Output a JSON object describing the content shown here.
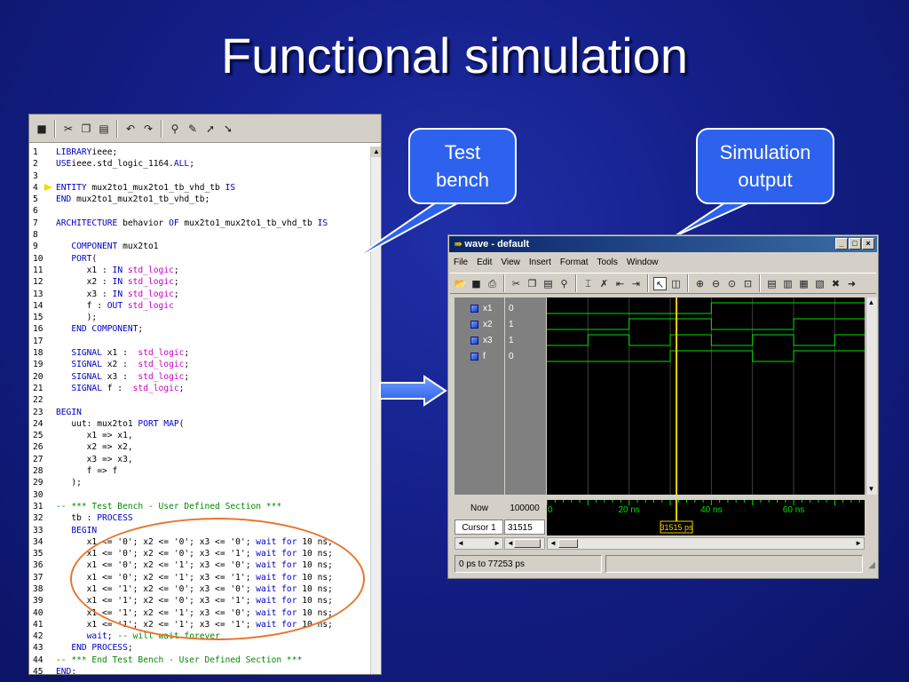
{
  "slide": {
    "title": "Functional simulation"
  },
  "callouts": {
    "testbench": [
      "Test",
      "bench"
    ],
    "output": [
      "Simulation",
      "output"
    ]
  },
  "editor": {
    "toolbar_icons": [
      "save-icon",
      "cut-icon",
      "copy-icon",
      "paste-icon",
      "undo-icon",
      "redo-icon",
      "find-icon",
      "mark-icon",
      "next-mark-icon",
      "prev-mark-icon"
    ],
    "current_line": 4,
    "lines": [
      {
        "n": "1",
        "t": [
          [
            "kw",
            "LIBRARY"
          ],
          [
            "",
            "ieee;"
          ]
        ]
      },
      {
        "n": "2",
        "t": [
          [
            "kw",
            "USE"
          ],
          [
            "",
            "ieee.std_logic_1164."
          ],
          [
            "kw",
            "ALL"
          ],
          [
            "",
            ";"
          ]
        ]
      },
      {
        "n": "3",
        "t": []
      },
      {
        "n": "4",
        "t": [
          [
            "kw",
            "ENTITY"
          ],
          [
            "",
            " mux2to1_mux2to1_tb_vhd_tb "
          ],
          [
            "kw",
            "IS"
          ]
        ]
      },
      {
        "n": "5",
        "t": [
          [
            "kw",
            "END"
          ],
          [
            "",
            " mux2to1_mux2to1_tb_vhd_tb;"
          ]
        ]
      },
      {
        "n": "6",
        "t": []
      },
      {
        "n": "7",
        "t": [
          [
            "kw",
            "ARCHITECTURE"
          ],
          [
            "",
            " behavior "
          ],
          [
            "kw",
            "OF"
          ],
          [
            "",
            " mux2to1_mux2to1_tb_vhd_tb "
          ],
          [
            "kw",
            "IS"
          ]
        ]
      },
      {
        "n": "8",
        "t": []
      },
      {
        "n": "9",
        "t": [
          [
            "",
            "   "
          ],
          [
            "kw",
            "COMPONENT"
          ],
          [
            "",
            " mux2to1"
          ]
        ]
      },
      {
        "n": "10",
        "t": [
          [
            "",
            "   "
          ],
          [
            "kw",
            "PORT"
          ],
          [
            "",
            "("
          ]
        ]
      },
      {
        "n": "11",
        "t": [
          [
            "",
            "      x1 : "
          ],
          [
            "kw",
            "IN"
          ],
          [
            "",
            "",
            " "
          ],
          [
            "ty",
            " std_logic"
          ],
          [
            "",
            ";"
          ]
        ]
      },
      {
        "n": "12",
        "t": [
          [
            "",
            "      x2 : "
          ],
          [
            "kw",
            "IN"
          ],
          [
            "ty",
            " std_logic"
          ],
          [
            "",
            ";"
          ]
        ]
      },
      {
        "n": "13",
        "t": [
          [
            "",
            "      x3 : "
          ],
          [
            "kw",
            "IN"
          ],
          [
            "ty",
            " std_logic"
          ],
          [
            "",
            ";"
          ]
        ]
      },
      {
        "n": "14",
        "t": [
          [
            "",
            "      f : "
          ],
          [
            "kw",
            "OUT"
          ],
          [
            "ty",
            " std_logic"
          ]
        ]
      },
      {
        "n": "15",
        "t": [
          [
            "",
            "      );"
          ]
        ]
      },
      {
        "n": "16",
        "t": [
          [
            "",
            "   "
          ],
          [
            "kw",
            "END COMPONENT"
          ],
          [
            "",
            ";"
          ]
        ]
      },
      {
        "n": "17",
        "t": []
      },
      {
        "n": "18",
        "t": [
          [
            "",
            "   "
          ],
          [
            "kw",
            "SIGNAL"
          ],
          [
            "",
            " x1 :  "
          ],
          [
            "ty",
            "std_logic"
          ],
          [
            "",
            ";"
          ]
        ]
      },
      {
        "n": "19",
        "t": [
          [
            "",
            "   "
          ],
          [
            "kw",
            "SIGNAL"
          ],
          [
            "",
            " x2 :  "
          ],
          [
            "ty",
            "std_logic"
          ],
          [
            "",
            ";"
          ]
        ]
      },
      {
        "n": "20",
        "t": [
          [
            "",
            "   "
          ],
          [
            "kw",
            "SIGNAL"
          ],
          [
            "",
            " x3 :  "
          ],
          [
            "ty",
            "std_logic"
          ],
          [
            "",
            ";"
          ]
        ]
      },
      {
        "n": "21",
        "t": [
          [
            "",
            "   "
          ],
          [
            "kw",
            "SIGNAL"
          ],
          [
            "",
            " f :  "
          ],
          [
            "ty",
            "std_logic"
          ],
          [
            "",
            ";"
          ]
        ]
      },
      {
        "n": "22",
        "t": []
      },
      {
        "n": "23",
        "t": [
          [
            "kw",
            "BEGIN"
          ]
        ]
      },
      {
        "n": "24",
        "t": [
          [
            "",
            "   uut: mux2to1 "
          ],
          [
            "kw",
            "PORT MAP"
          ],
          [
            "",
            "("
          ]
        ]
      },
      {
        "n": "25",
        "t": [
          [
            "",
            "      x1 => x1,"
          ]
        ]
      },
      {
        "n": "26",
        "t": [
          [
            "",
            "      x2 => x2,"
          ]
        ]
      },
      {
        "n": "27",
        "t": [
          [
            "",
            "      x3 => x3,"
          ]
        ]
      },
      {
        "n": "28",
        "t": [
          [
            "",
            "      f => f"
          ]
        ]
      },
      {
        "n": "29",
        "t": [
          [
            "",
            "   );"
          ]
        ]
      },
      {
        "n": "30",
        "t": []
      },
      {
        "n": "31",
        "t": [
          [
            "cm",
            "-- *** Test Bench - User Defined Section ***"
          ]
        ]
      },
      {
        "n": "32",
        "t": [
          [
            "",
            "   tb : "
          ],
          [
            "kw",
            "PROCESS"
          ]
        ]
      },
      {
        "n": "33",
        "t": [
          [
            "",
            "   "
          ],
          [
            "kw",
            "BEGIN"
          ]
        ]
      },
      {
        "n": "34",
        "t": [
          [
            "",
            "      x1 <= '0'; x2 <= '0'; x3 <= '0'; "
          ],
          [
            "kw",
            "wait for"
          ],
          [
            "",
            " 10 ns;"
          ]
        ]
      },
      {
        "n": "35",
        "t": [
          [
            "",
            "      x1 <= '0'; x2 <= '0'; x3 <= '1'; "
          ],
          [
            "kw",
            "wait for"
          ],
          [
            "",
            " 10 ns;"
          ]
        ]
      },
      {
        "n": "36",
        "t": [
          [
            "",
            "      x1 <= '0'; x2 <= '1'; x3 <= '0'; "
          ],
          [
            "kw",
            "wait for"
          ],
          [
            "",
            " 10 ns;"
          ]
        ]
      },
      {
        "n": "37",
        "t": [
          [
            "",
            "      x1 <= '0'; x2 <= '1'; x3 <= '1'; "
          ],
          [
            "kw",
            "wait for"
          ],
          [
            "",
            " 10 ns;"
          ]
        ]
      },
      {
        "n": "38",
        "t": [
          [
            "",
            "      x1 <= '1'; x2 <= '0'; x3 <= '0'; "
          ],
          [
            "kw",
            "wait for"
          ],
          [
            "",
            " 10 ns;"
          ]
        ]
      },
      {
        "n": "39",
        "t": [
          [
            "",
            "      x1 <= '1'; x2 <= '0'; x3 <= '1'; "
          ],
          [
            "kw",
            "wait for"
          ],
          [
            "",
            " 10 ns;"
          ]
        ]
      },
      {
        "n": "40",
        "t": [
          [
            "",
            "      x1 <= '1'; x2 <= '1'; x3 <= '0'; "
          ],
          [
            "kw",
            "wait for"
          ],
          [
            "",
            " 10 ns;"
          ]
        ]
      },
      {
        "n": "41",
        "t": [
          [
            "",
            "      x1 <= '1'; x2 <= '1'; x3 <= '1'; "
          ],
          [
            "kw",
            "wait for"
          ],
          [
            "",
            " 10 ns;"
          ]
        ]
      },
      {
        "n": "42",
        "t": [
          [
            "",
            "      "
          ],
          [
            "kw",
            "wait"
          ],
          [
            "",
            "; "
          ],
          [
            "cm",
            "-- will wait forever"
          ]
        ]
      },
      {
        "n": "43",
        "t": [
          [
            "",
            "   "
          ],
          [
            "kw",
            "END PROCESS"
          ],
          [
            "",
            ";"
          ]
        ]
      },
      {
        "n": "44",
        "t": [
          [
            "cm",
            "-- *** End Test Bench - User Defined Section ***"
          ]
        ]
      },
      {
        "n": "45",
        "t": [
          [
            "kw",
            "END"
          ],
          [
            "",
            ";"
          ]
        ]
      }
    ]
  },
  "wave": {
    "title": "wave - default",
    "window_buttons": [
      "_",
      "□",
      "×"
    ],
    "menu": [
      "File",
      "Edit",
      "View",
      "Insert",
      "Format",
      "Tools",
      "Window"
    ],
    "toolbar_icons": [
      "open-icon",
      "save-icon",
      "print-icon",
      "cut-icon",
      "copy-icon",
      "paste-icon",
      "find-icon",
      "insert-cursor-icon",
      "delete-cursor-icon",
      "prev-edge-icon",
      "next-edge-icon",
      "select-mode-icon",
      "zoom-mode-icon",
      "zoom-in-icon",
      "zoom-out-icon",
      "zoom-full-icon",
      "zoom-cursor-icon",
      "run-icon",
      "step-icon",
      "break-icon",
      "restart-icon",
      "stop-icon",
      "continue-icon"
    ],
    "signals": [
      {
        "name": "x1",
        "value": "0"
      },
      {
        "name": "x2",
        "value": "1"
      },
      {
        "name": "x3",
        "value": "1"
      },
      {
        "name": "f",
        "value": "0"
      }
    ],
    "now_label": "Now",
    "now_value": "100000 ps",
    "cursor_label": "Cursor 1",
    "cursor_value": "31515 ps",
    "cursor_marker": "31515 ps",
    "ruler_labels": [
      "0",
      "20 ns",
      "40 ns",
      "60 ns"
    ],
    "status_text": "0 ps to 77253 ps",
    "time_range_ns": [
      0,
      77.253
    ],
    "cursor_ns": 31.515,
    "step_ns": 10,
    "colors": {
      "trace": "#00e000",
      "cursor": "#f0d000",
      "grid": "#404040"
    }
  }
}
